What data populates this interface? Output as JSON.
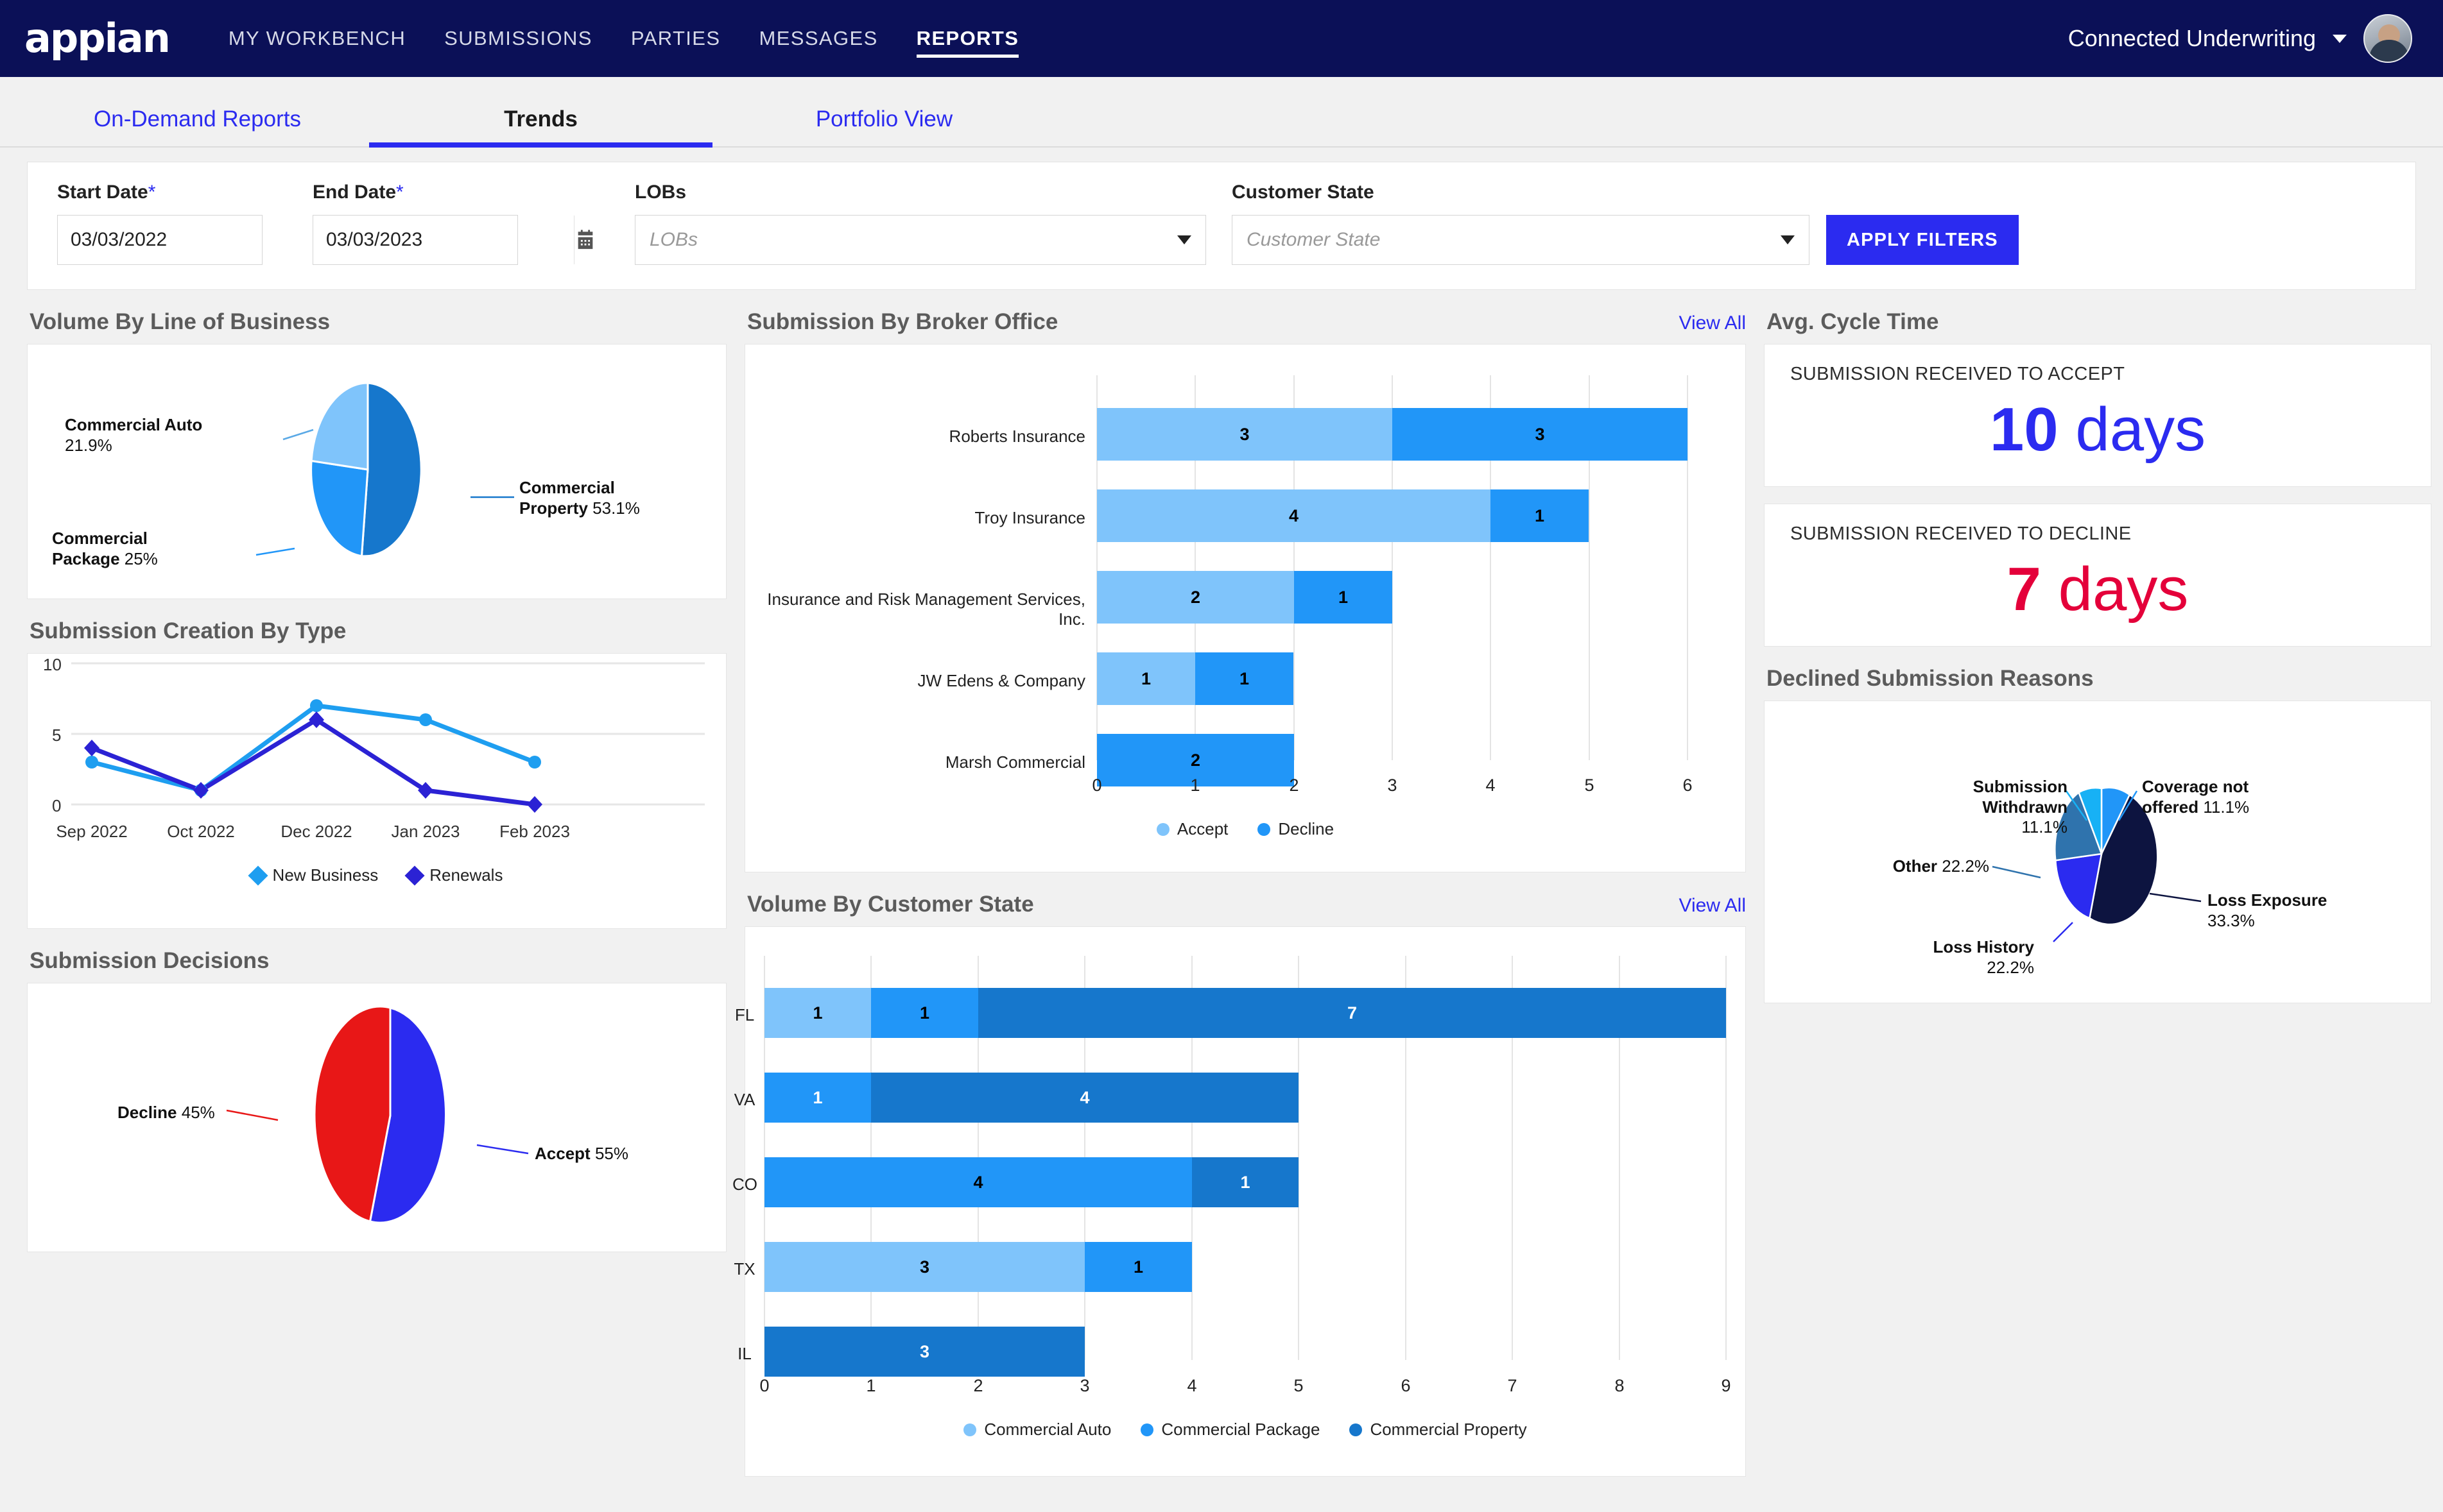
{
  "header": {
    "logo": "appian",
    "nav": [
      {
        "label": "MY WORKBENCH",
        "active": false
      },
      {
        "label": "SUBMISSIONS",
        "active": false
      },
      {
        "label": "PARTIES",
        "active": false
      },
      {
        "label": "MESSAGES",
        "active": false
      },
      {
        "label": "REPORTS",
        "active": true
      }
    ],
    "user": "Connected Underwriting"
  },
  "tabs": [
    {
      "label": "On-Demand Reports",
      "active": false
    },
    {
      "label": "Trends",
      "active": true
    },
    {
      "label": "Portfolio View",
      "active": false
    }
  ],
  "filters": {
    "start_date_label": "Start Date",
    "start_date_value": "03/03/2022",
    "end_date_label": "End Date",
    "end_date_value": "03/03/2023",
    "lobs_label": "LOBs",
    "lobs_placeholder": "LOBs",
    "customer_state_label": "Customer State",
    "customer_state_placeholder": "Customer State",
    "apply_button": "APPLY FILTERS",
    "required_marker": "*"
  },
  "sections": {
    "volume_by_lob": "Volume By Line of Business",
    "submission_creation_by_type": "Submission Creation By Type",
    "submission_decisions": "Submission Decisions",
    "submission_by_broker_office": "Submission By Broker Office",
    "volume_by_customer_state": "Volume By Customer State",
    "avg_cycle_time": "Avg. Cycle Time",
    "declined_submission_reasons": "Declined Submission Reasons",
    "view_all": "View All"
  },
  "kpis": [
    {
      "label": "SUBMISSION RECEIVED TO ACCEPT",
      "number": "10",
      "unit": "days",
      "color": "#2b2bf0"
    },
    {
      "label": "SUBMISSION RECEIVED TO DECLINE",
      "number": "7",
      "unit": "days",
      "color": "#e4003a"
    }
  ],
  "colors": {
    "brand_navy": "#0b1057",
    "accent_blue": "#2b2bf0",
    "light_blue": "#7fc4fb",
    "mid_blue": "#2196f8",
    "dark_blue": "#1677cc",
    "navy_pie": "#0d1440",
    "steel_blue": "#2f73ad",
    "cyan": "#17b1f5",
    "red": "#e4003a"
  },
  "chart_data": [
    {
      "type": "pie",
      "name": "volume-by-line-of-business",
      "title": "Volume By Line of Business",
      "labels": [
        "Commercial Property",
        "Commercial Package",
        "Commercial Auto"
      ],
      "values": [
        53.1,
        25,
        21.9
      ],
      "value_labels": [
        "53.1%",
        "25%",
        "21.9%"
      ],
      "colors": [
        "#1677cc",
        "#2196f8",
        "#7fc4fb"
      ],
      "legend": "callout-labels"
    },
    {
      "type": "line",
      "name": "submission-creation-by-type",
      "title": "Submission Creation By Type",
      "categories": [
        "Sep 2022",
        "Oct 2022",
        "Dec 2022",
        "Jan 2023",
        "Feb 2023"
      ],
      "series": [
        {
          "name": "New Business",
          "values": [
            3,
            1,
            7,
            6,
            3
          ],
          "color": "#1e9ef0"
        },
        {
          "name": "Renewals",
          "values": [
            4,
            1,
            6,
            1,
            0
          ],
          "color": "#2b22d4"
        }
      ],
      "ylim": [
        0,
        10
      ],
      "yticks": [
        0,
        5,
        10
      ],
      "grid": true,
      "legend_position": "bottom"
    },
    {
      "type": "pie",
      "name": "submission-decisions",
      "title": "Submission Decisions",
      "labels": [
        "Accept",
        "Decline"
      ],
      "values": [
        55,
        45
      ],
      "value_labels": [
        "55%",
        "45%"
      ],
      "colors": [
        "#2b2bf0",
        "#e81717"
      ],
      "legend": "callout-labels"
    },
    {
      "type": "bar",
      "name": "submission-by-broker-office",
      "title": "Submission By Broker Office",
      "orientation": "horizontal",
      "stacked": true,
      "categories": [
        "Roberts Insurance",
        "Troy Insurance",
        "Insurance and Risk Management Services, Inc.",
        "JW Edens & Company",
        "Marsh Commercial"
      ],
      "series": [
        {
          "name": "Accept",
          "color": "#7fc4fb",
          "values": [
            3,
            4,
            2,
            1,
            0
          ]
        },
        {
          "name": "Decline",
          "color": "#2196f8",
          "values": [
            3,
            1,
            1,
            1,
            2
          ]
        }
      ],
      "xlim": [
        0,
        6
      ],
      "xticks": [
        0,
        1,
        2,
        3,
        4,
        5,
        6
      ],
      "legend_position": "bottom"
    },
    {
      "type": "bar",
      "name": "volume-by-customer-state",
      "title": "Volume By Customer State",
      "orientation": "horizontal",
      "stacked": true,
      "categories": [
        "FL",
        "VA",
        "CO",
        "TX",
        "IL"
      ],
      "series": [
        {
          "name": "Commercial Auto",
          "color": "#7fc4fb",
          "values": [
            1,
            0,
            0,
            3,
            0
          ]
        },
        {
          "name": "Commercial Package",
          "color": "#2196f8",
          "values": [
            1,
            1,
            4,
            1,
            0
          ]
        },
        {
          "name": "Commercial Property",
          "color": "#1677cc",
          "values": [
            7,
            4,
            1,
            0,
            3
          ]
        }
      ],
      "xlim": [
        0,
        9
      ],
      "xticks": [
        0,
        1,
        2,
        3,
        4,
        5,
        6,
        7,
        8,
        9
      ],
      "legend_position": "bottom"
    },
    {
      "type": "pie",
      "name": "declined-submission-reasons",
      "title": "Declined Submission Reasons",
      "labels": [
        "Loss Exposure",
        "Loss History",
        "Other",
        "Submission Withdrawn",
        "Coverage not offered"
      ],
      "values": [
        33.3,
        22.2,
        22.2,
        11.1,
        11.1
      ],
      "value_labels": [
        "33.3%",
        "22.2%",
        "22.2%",
        "11.1%",
        "11.1%"
      ],
      "colors": [
        "#0d1440",
        "#2b2bf0",
        "#2f73ad",
        "#17b1f5",
        "#2196f8"
      ],
      "legend": "callout-labels"
    }
  ]
}
